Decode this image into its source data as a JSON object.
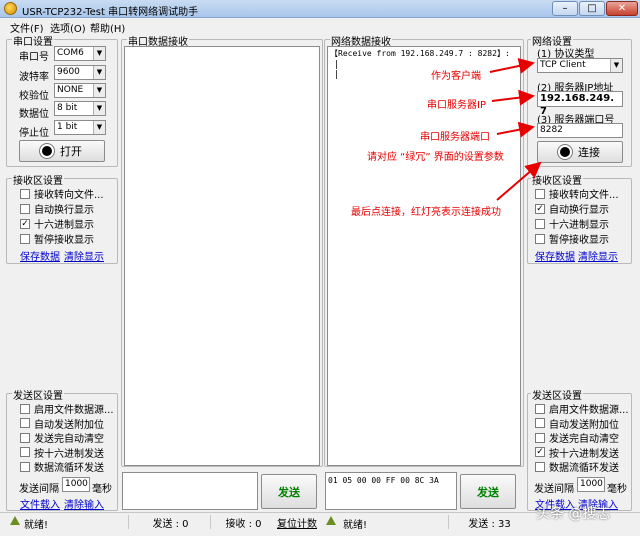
{
  "window": {
    "title": "USR-TCP232-Test 串口转网络调试助手",
    "min_glyph": "–",
    "max_glyph": "□",
    "close_glyph": "✕"
  },
  "menu": [
    "文件(F)",
    "选项(O)",
    "帮助(H)"
  ],
  "serial_settings": {
    "title": "串口设置",
    "fields": [
      {
        "label": "串口号",
        "value": "COM6"
      },
      {
        "label": "波特率",
        "value": "9600"
      },
      {
        "label": "校验位",
        "value": "NONE"
      },
      {
        "label": "数据位",
        "value": "8 bit"
      },
      {
        "label": "停止位",
        "value": "1 bit"
      }
    ],
    "open_button": "打开"
  },
  "left_receive_settings": {
    "title": "接收区设置",
    "options": [
      {
        "label": "接收转向文件...",
        "checked": false
      },
      {
        "label": "自动换行显示",
        "checked": false
      },
      {
        "label": "十六进制显示",
        "checked": true
      },
      {
        "label": "暂停接收显示",
        "checked": false
      }
    ],
    "save_link": "保存数据",
    "clear_link": "清除显示"
  },
  "left_send_settings": {
    "title": "发送区设置",
    "options": [
      {
        "label": "启用文件数据源...",
        "checked": false
      },
      {
        "label": "自动发送附加位",
        "checked": false
      },
      {
        "label": "发送完自动清空",
        "checked": false
      },
      {
        "label": "按十六进制发送",
        "checked": false
      },
      {
        "label": "数据流循环发送",
        "checked": false
      }
    ],
    "interval_label": "发送间隔",
    "interval_value": "1000",
    "interval_unit": "毫秒",
    "file_link": "文件载入",
    "clear_link": "清除输入"
  },
  "serial_receive": {
    "title": "串口数据接收",
    "content": ""
  },
  "serial_send": {
    "content": "",
    "button": "发送"
  },
  "net_receive": {
    "title": "网络数据接收",
    "line": "【Receive from 192.168.249.7 : 8282】:",
    "cursor1": "|",
    "cursor2": "|"
  },
  "net_send": {
    "content": "01 05 00 00 FF 00 8C 3A",
    "button": "发送"
  },
  "net_settings": {
    "title": "网络设置",
    "protocol_label": "(1) 协议类型",
    "protocol_value": "TCP Client",
    "ip_label": "(2) 服务器IP地址",
    "ip_value": "192.168.249. 7",
    "port_label": "(3) 服务器端口号",
    "port_value": "8282",
    "connect_button": "连接"
  },
  "right_receive_settings": {
    "title": "接收区设置",
    "options": [
      {
        "label": "接收转向文件...",
        "checked": false
      },
      {
        "label": "自动换行显示",
        "checked": true
      },
      {
        "label": "十六进制显示",
        "checked": false
      },
      {
        "label": "暂停接收显示",
        "checked": false
      }
    ],
    "save_link": "保存数据",
    "clear_link": "清除显示"
  },
  "right_send_settings": {
    "title": "发送区设置",
    "options": [
      {
        "label": "启用文件数据源...",
        "checked": false
      },
      {
        "label": "自动发送附加位",
        "checked": false
      },
      {
        "label": "发送完自动清空",
        "checked": false
      },
      {
        "label": "按十六进制发送",
        "checked": true
      },
      {
        "label": "数据流循环发送",
        "checked": false
      }
    ],
    "interval_label": "发送间隔",
    "interval_value": "1000",
    "interval_unit": "毫秒",
    "file_link": "文件载入",
    "clear_link": "清除输入"
  },
  "annotations": {
    "client": "作为客户端",
    "server_ip": "串口服务器IP",
    "server_port": "串口服务器端口",
    "match": "请对应 “绿冗” 界面的设置参数",
    "connect": "最后点连接，红灯亮表示连接成功",
    "color": "#e60000"
  },
  "status": {
    "left_ready": "就绪!",
    "left_send": "发送 : 0",
    "left_recv": "接收 : 0",
    "left_reset": "复位计数",
    "right_ready": "就绪!",
    "right_send": "发送 : 33"
  },
  "watermark": "头条 @搜志"
}
